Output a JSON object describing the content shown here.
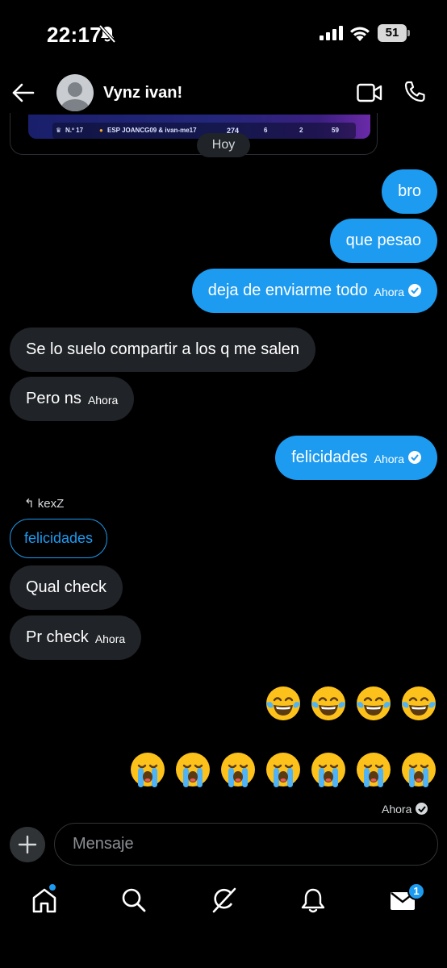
{
  "status_bar": {
    "time": "22:17",
    "battery": "51"
  },
  "header": {
    "contact_name": "Vynz ivan!"
  },
  "shared_card": {
    "rank": "N.º 17",
    "players": "ESP JOANCG09 & ivan-me17",
    "stat_1": "274",
    "stat_2": "6",
    "stat_3": "2",
    "stat_4": "59"
  },
  "date_separator": "Hoy",
  "messages": [
    {
      "direction": "out",
      "text": "bro"
    },
    {
      "direction": "out",
      "text": "que pesao"
    },
    {
      "direction": "out",
      "text": "deja de enviarme todo",
      "time": "Ahora",
      "read": true
    },
    {
      "direction": "in",
      "text": "Se lo suelo compartir a los q me salen"
    },
    {
      "direction": "in",
      "text": "Pero ns",
      "time": "Ahora"
    },
    {
      "direction": "out",
      "text": "felicidades",
      "time": "Ahora",
      "read": true
    },
    {
      "direction": "in",
      "reply_to_user": "kexZ",
      "quoted_text": "felicidades"
    },
    {
      "direction": "in",
      "text": "Qual check"
    },
    {
      "direction": "in",
      "text": "Pr check",
      "time": "Ahora"
    }
  ],
  "emoji_rows": [
    {
      "emoji": "face-with-tears-of-joy",
      "count": 4
    },
    {
      "emoji": "loudly-crying-face",
      "count": 7
    }
  ],
  "last_status": {
    "time": "Ahora",
    "read": true
  },
  "composer": {
    "placeholder": "Mensaje"
  },
  "bottom_nav": {
    "items": [
      "home-icon",
      "search-icon",
      "grok-icon",
      "notifications-icon",
      "messages-icon"
    ],
    "messages_badge": "1"
  },
  "colors": {
    "accent": "#1d9bf0",
    "incoming_bubble": "#202327",
    "background": "#000000"
  }
}
